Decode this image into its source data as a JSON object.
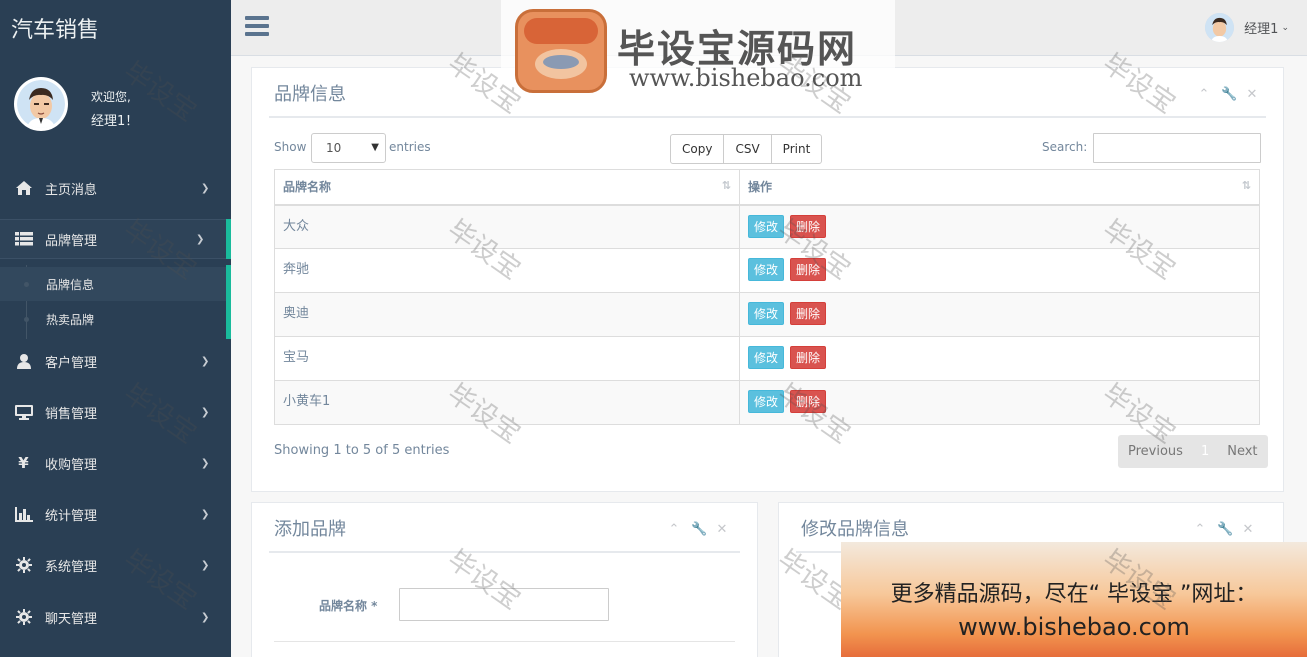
{
  "sidebar": {
    "app_title": "汽车销售",
    "welcome": "欢迎您,",
    "username": "经理1！",
    "menu": [
      {
        "label": "主页消息",
        "icon": "home-icon"
      },
      {
        "label": "品牌管理",
        "icon": "list-icon"
      },
      {
        "label": "客户管理",
        "icon": "user-icon"
      },
      {
        "label": "销售管理",
        "icon": "desktop-icon"
      },
      {
        "label": "收购管理",
        "icon": "yen-icon"
      },
      {
        "label": "统计管理",
        "icon": "bar-chart-icon"
      },
      {
        "label": "系统管理",
        "icon": "gear-icon"
      },
      {
        "label": "聊天管理",
        "icon": "gear-icon"
      }
    ],
    "submenu": [
      {
        "label": "品牌信息"
      },
      {
        "label": "热卖品牌"
      }
    ]
  },
  "topnav": {
    "username": "经理1"
  },
  "brand_panel": {
    "title": "品牌信息",
    "show_label": "Show",
    "entries_label": "entries",
    "page_length": "10",
    "buttons": [
      "Copy",
      "CSV",
      "Print"
    ],
    "search_label": "Search:",
    "columns": [
      "品牌名称",
      "操作"
    ],
    "rows": [
      {
        "name": "大众"
      },
      {
        "name": "奔驰"
      },
      {
        "name": "奥迪"
      },
      {
        "name": "宝马"
      },
      {
        "name": "小黄车1"
      }
    ],
    "edit_label": "修改",
    "delete_label": "删除",
    "info": "Showing 1 to 5 of 5 entries",
    "prev": "Previous",
    "page": "1",
    "next": "Next"
  },
  "add_panel": {
    "title": "添加品牌",
    "field_label": "品牌名称 *"
  },
  "edit_panel": {
    "title": "修改品牌信息"
  },
  "watermark": {
    "text": "毕设宝",
    "logo_text": "毕设宝源码网",
    "logo_url": "www.bishebao.com",
    "promo_line1": "更多精品源码，尽在“ 毕设宝 ”网址：",
    "promo_line2": "www.bishebao.com"
  }
}
